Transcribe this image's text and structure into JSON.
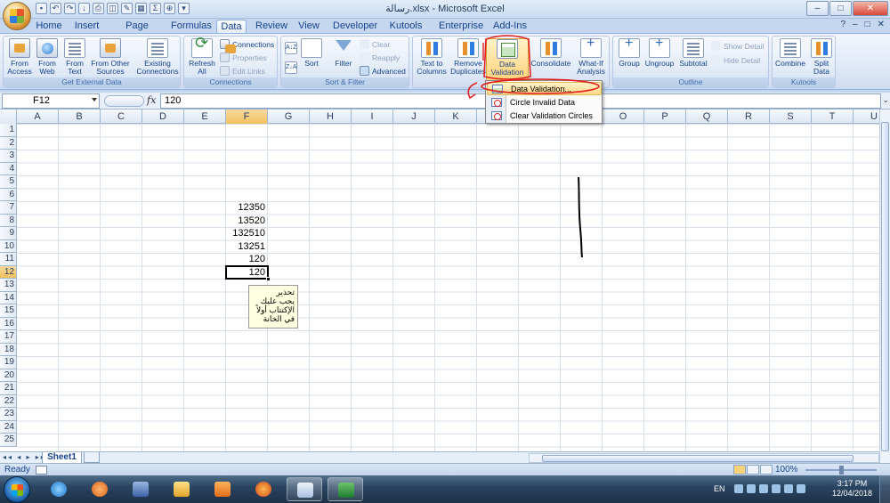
{
  "window": {
    "title": "رسالة.xlsx - Microsoft Excel",
    "controls": [
      "–",
      "□",
      "✕"
    ]
  },
  "tabs": [
    {
      "label": "Home",
      "active": false
    },
    {
      "label": "Insert",
      "active": false
    },
    {
      "label": "Page Layout",
      "active": false
    },
    {
      "label": "Formulas",
      "active": false
    },
    {
      "label": "Data",
      "active": true
    },
    {
      "label": "Review",
      "active": false
    },
    {
      "label": "View",
      "active": false
    },
    {
      "label": "Developer",
      "active": false
    },
    {
      "label": "Kutools ™",
      "active": false
    },
    {
      "label": "Enterprise",
      "active": false
    },
    {
      "label": "Add-Ins",
      "active": false
    }
  ],
  "ribbon": {
    "get_external": {
      "label": "Get External Data",
      "from_access": "From Access",
      "from_web": "From Web",
      "from_text": "From Text",
      "from_other": "From Other Sources",
      "existing": "Existing Connections"
    },
    "connections": {
      "label": "Connections",
      "refresh_all": "Refresh All",
      "connections": "Connections",
      "properties": "Properties",
      "edit_links": "Edit Links"
    },
    "sort_filter": {
      "label": "Sort & Filter",
      "az": "A↓Z",
      "za": "Z↓A",
      "sort": "Sort",
      "filter": "Filter",
      "clear": "Clear",
      "reapply": "Reapply",
      "advanced": "Advanced"
    },
    "data_tools": {
      "text_to_columns": "Text to Columns",
      "remove_duplicates": "Remove Duplicates",
      "data_validation": "Data Validation",
      "consolidate": "Consolidate",
      "what_if": "What-If Analysis"
    },
    "outline": {
      "label": "Outline",
      "group": "Group",
      "ungroup": "Ungroup",
      "subtotal": "Subtotal",
      "show_detail": "Show Detail",
      "hide_detail": "Hide Detail"
    },
    "kutools": {
      "label": "Kutools",
      "combine": "Combine",
      "split_data": "Split Data"
    }
  },
  "dv_menu": {
    "items": [
      {
        "label": "Data Validation..."
      },
      {
        "label": "Circle Invalid Data"
      },
      {
        "label": "Clear Validation Circles"
      }
    ]
  },
  "formula_bar": {
    "name_box": "F12",
    "fx": "fx",
    "value": "120"
  },
  "grid": {
    "columns": [
      "A",
      "B",
      "C",
      "D",
      "E",
      "F",
      "G",
      "H",
      "I",
      "J",
      "K",
      "L",
      "M",
      "N",
      "O",
      "P",
      "Q",
      "R",
      "S",
      "T",
      "U"
    ],
    "rows": [
      "1",
      "2",
      "3",
      "4",
      "5",
      "6",
      "7",
      "8",
      "9",
      "10",
      "11",
      "12",
      "13",
      "14",
      "15",
      "16",
      "17",
      "18",
      "19",
      "20",
      "21",
      "22",
      "23",
      "24",
      "25"
    ],
    "selected_column": "F",
    "selected_row": "12",
    "cells": [
      {
        "ref": "F7",
        "value": "12350"
      },
      {
        "ref": "F8",
        "value": "13520"
      },
      {
        "ref": "F9",
        "value": "132510"
      },
      {
        "ref": "F10",
        "value": "13251"
      },
      {
        "ref": "F11",
        "value": "120"
      },
      {
        "ref": "F12",
        "value": "120"
      }
    ],
    "input_message": {
      "title": "تحذير",
      "body": "يجب عليك الإكتتاب أولاً في الخانة"
    }
  },
  "sheets": {
    "nav": "◂◂ ◂ ▸ ▸▸",
    "tabs": [
      "Sheet1"
    ]
  },
  "status": {
    "ready": "Ready",
    "zoom": "100%"
  },
  "taskbar": {
    "lang": "EN",
    "time": "3:17 PM",
    "date": "12/04/2018"
  }
}
